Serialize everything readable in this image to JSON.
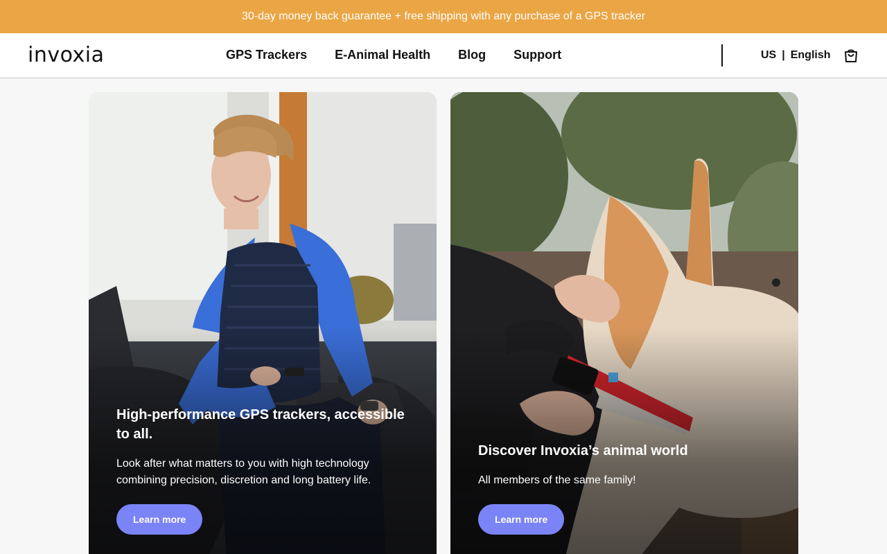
{
  "promo": {
    "text": "30-day money back guarantee + free shipping with any purchase of a GPS tracker"
  },
  "header": {
    "logo": "invoxia",
    "nav": [
      "GPS Trackers",
      "E-Animal Health",
      "Blog",
      "Support"
    ],
    "locale": {
      "country": "US",
      "separator": "|",
      "language": "English"
    },
    "cart_icon": "shopping-bag-icon"
  },
  "cards": [
    {
      "title": "High-performance GPS trackers, accessible to all.",
      "text": "Look after what matters to you with high technology combining precision, discretion and long battery life.",
      "button": "Learn more"
    },
    {
      "title": "Discover Invoxia’s animal world",
      "text": "All members of the same family!",
      "button": "Learn more"
    }
  ],
  "colors": {
    "promo_bg": "#eaa544",
    "button_bg": "#7b84f6",
    "accent_dog_collar": "#d8262c",
    "hoodie_blue": "#3a6ed8"
  }
}
